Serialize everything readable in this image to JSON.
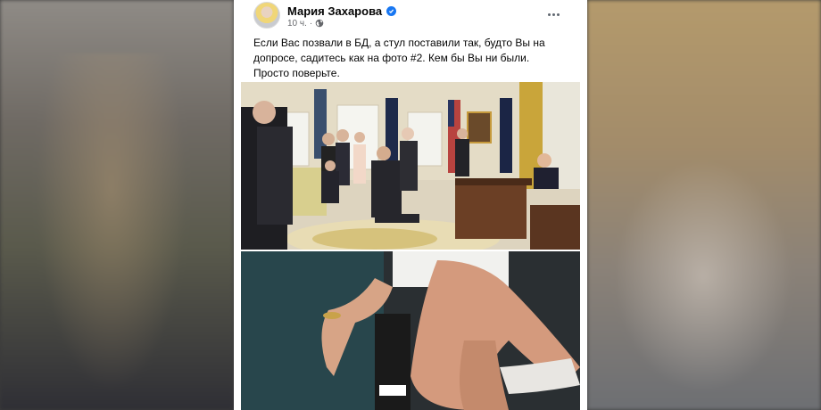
{
  "post": {
    "author": "Мария Захарова",
    "time": "10 ч.",
    "text_lines": [
      "Если Вас позвали в БД, а стул поставили так, будто Вы на",
      "допросе, садитесь как на фото #2. Кем бы Вы ни были.",
      "Просто поверьте."
    ]
  },
  "icons": {
    "verified": "verified-badge-icon",
    "audience": "globe-icon",
    "more": "more-options-icon"
  },
  "colors": {
    "verified": "#1877f2",
    "text": "#050505",
    "meta": "#65676b",
    "card": "#ffffff"
  }
}
